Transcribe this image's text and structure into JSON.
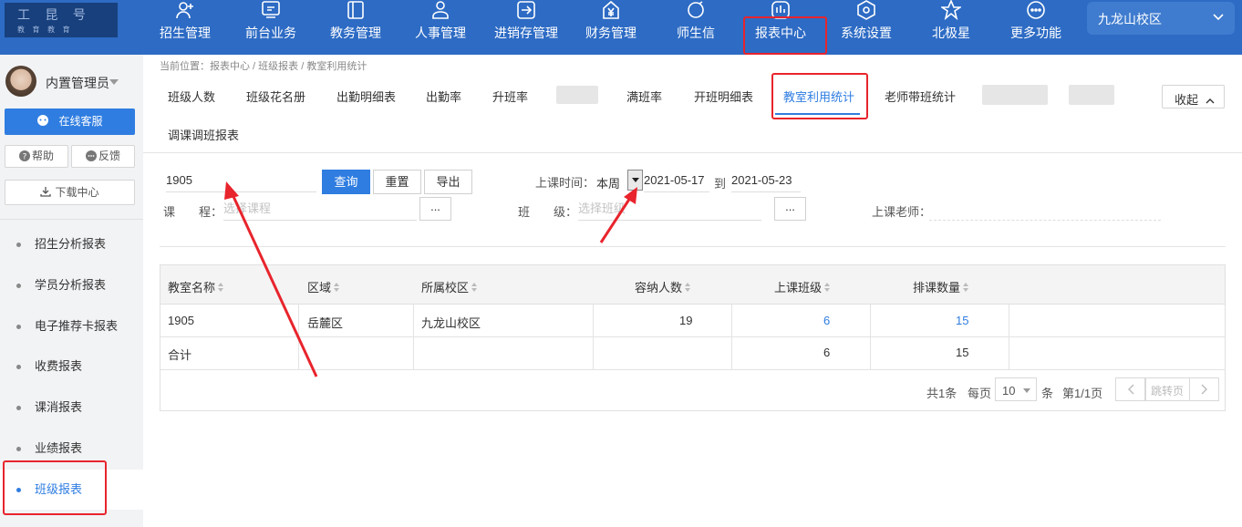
{
  "logo": {
    "line1": "工 昆 号",
    "line2": "教 育 教 育"
  },
  "nav": [
    {
      "label": "招生管理",
      "icon": "user-plus-icon"
    },
    {
      "label": "前台业务",
      "icon": "monitor-icon"
    },
    {
      "label": "教务管理",
      "icon": "book-icon"
    },
    {
      "label": "人事管理",
      "icon": "person-icon"
    },
    {
      "label": "进销存管理",
      "icon": "exchange-icon"
    },
    {
      "label": "财务管理",
      "icon": "yen-icon"
    },
    {
      "label": "师生信",
      "icon": "chat-icon"
    },
    {
      "label": "报表中心",
      "icon": "bar-chart-icon"
    },
    {
      "label": "系统设置",
      "icon": "gear-icon"
    },
    {
      "label": "北极星",
      "icon": "star-icon"
    },
    {
      "label": "更多功能",
      "icon": "more-icon"
    }
  ],
  "campus": "九龙山校区",
  "sidebar": {
    "user_name": "内置管理员",
    "kefu": "在线客服",
    "help": "帮助",
    "feedback": "反馈",
    "download": "下载中心",
    "items": [
      "招生分析报表",
      "学员分析报表",
      "电子推荐卡报表",
      "收费报表",
      "课消报表",
      "业绩报表",
      "班级报表"
    ]
  },
  "breadcrumb": "当前位置：报表中心 / 班级报表 / 教室利用统计",
  "tabs": [
    "班级人数",
    "班级花名册",
    "出勤明细表",
    "出勤率",
    "升班率",
    "满班率",
    "开班明细表",
    "教室利用统计",
    "老师带班统计",
    "调课调班报表"
  ],
  "collapse_label": "收起",
  "filters": {
    "keyword": "1905",
    "query": "查询",
    "reset": "重置",
    "export": "导出",
    "time_label": "上课时间：",
    "period": "本周",
    "date_from": "2021-05-17",
    "to": "到",
    "date_to": "2021-05-23",
    "course_label": "课　　程：",
    "course_placeholder": "选择课程",
    "class_label": "班　　级：",
    "class_placeholder": "选择班级",
    "teacher_label": "上课老师：",
    "pick": "..."
  },
  "table": {
    "headers": [
      "教室名称",
      "区域",
      "所属校区",
      "容纳人数",
      "上课班级",
      "排课数量"
    ],
    "row": {
      "name": "1905",
      "area": "岳麓区",
      "campus": "九龙山校区",
      "capacity": "19",
      "classes": "6",
      "lessons": "15"
    },
    "total": {
      "label": "合计",
      "classes": "6",
      "lessons": "15"
    }
  },
  "pager": {
    "total": "共1条",
    "per": "每页",
    "size": "10",
    "unit": "条",
    "page": "第1/1页",
    "jump": "跳转页"
  },
  "colors": {
    "nav_bg": "#2d6bc4",
    "accent": "#2f7de1",
    "highlight": "#e8242c"
  }
}
